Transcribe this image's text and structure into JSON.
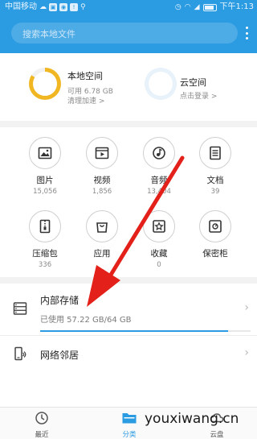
{
  "status_bar": {
    "carrier": "中国移动",
    "time": "下午1:13"
  },
  "search": {
    "placeholder": "搜索本地文件"
  },
  "storage": {
    "local": {
      "title": "本地空间",
      "available": "可用 6.78 GB",
      "action": "清理加速 >",
      "used_fraction": 0.84,
      "ring_color": "#f0b722"
    },
    "cloud": {
      "title": "云空间",
      "action": "点击登录 >",
      "ring_color": "#e7f2fb"
    }
  },
  "categories": [
    {
      "label": "图片",
      "count": "15,056",
      "icon": "image-icon"
    },
    {
      "label": "视频",
      "count": "1,856",
      "icon": "video-icon"
    },
    {
      "label": "音频",
      "count": "13,404",
      "icon": "music-icon"
    },
    {
      "label": "文档",
      "count": "39",
      "icon": "document-icon"
    },
    {
      "label": "压缩包",
      "count": "336",
      "icon": "zip-icon"
    },
    {
      "label": "应用",
      "count": "",
      "icon": "app-bag-icon"
    },
    {
      "label": "收藏",
      "count": "0",
      "icon": "favorite-star-icon"
    },
    {
      "label": "保密柜",
      "count": "",
      "icon": "safe-icon"
    }
  ],
  "internal_storage": {
    "title": "内部存储",
    "usage": "已使用 57.22 GB/64 GB",
    "used_fraction": 0.894
  },
  "network": {
    "title": "网络邻居"
  },
  "bottom_nav": [
    {
      "label": "最近",
      "icon": "clock-icon",
      "active": false
    },
    {
      "label": "分类",
      "icon": "folder-icon",
      "active": true
    },
    {
      "label": "云盘",
      "icon": "cloud-drive-icon",
      "active": false
    }
  ],
  "watermark": "youxiwang.cn",
  "colors": {
    "header": "#2b9be2",
    "accent": "#2b9be2",
    "annotation_arrow": "#e3211a"
  }
}
